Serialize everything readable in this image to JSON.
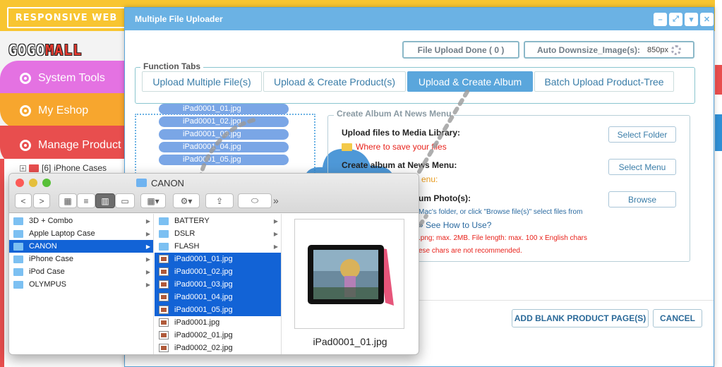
{
  "background": {
    "banner_text": "RESPONSIVE WEB",
    "brand_left": "GOGO",
    "brand_right": "MALL",
    "nav": [
      {
        "label": "System Tools"
      },
      {
        "label": "My Eshop"
      },
      {
        "label": "Manage Product"
      }
    ],
    "category": {
      "count": "[6]",
      "label": "iPhone Cases"
    }
  },
  "dialog": {
    "title": "Multiple File Uploader",
    "window_buttons": [
      "–",
      "⤢",
      "▾",
      "✕"
    ],
    "upload_done": "File Upload Done ( 0 )",
    "auto_downsize_label": "Auto Downsize_Image(s):",
    "auto_downsize_value": "850px",
    "function_tabs_legend": "Function Tabs",
    "tabs": [
      {
        "label": "Upload Multiple File(s)",
        "active": false
      },
      {
        "label": "Upload & Create Product(s)",
        "active": false
      },
      {
        "label": "Upload & Create Album",
        "active": true
      },
      {
        "label": "Batch Upload Product-Tree",
        "active": false
      }
    ],
    "dragged_files": [
      "iPad0001_01.jpg",
      "iPad0001_02.jpg",
      "iPad0001_03.jpg",
      "iPad0001_04.jpg",
      "iPad0001_05.jpg"
    ],
    "album": {
      "legend": "Create Album At News Menu",
      "upload_label": "Upload files to Media Library:",
      "where_save": "Where to save your files",
      "select_folder": "Select Folder",
      "create_label": "Create album at News Menu:",
      "create_note": "enu:",
      "select_menu": "Select Menu",
      "photo_label": "um Photo(s):",
      "browse": "Browse",
      "hint": "Mac's folder, or click \"Browse file(s)\" select files from",
      "howto": "» See How to Use?",
      "limits": ".png; max. 2MB. File length: max. 100 x English chars",
      "chars_note": "ese chars are not recommended."
    },
    "add_blank": "ADD BLANK PRODUCT PAGE(S)",
    "cancel": "CANCEL"
  },
  "finder": {
    "title": "CANON",
    "nav_back": "<",
    "nav_forward": ">",
    "more": "»",
    "col1": [
      {
        "label": "3D + Combo",
        "selected": false
      },
      {
        "label": "Apple Laptop Case",
        "selected": false
      },
      {
        "label": "CANON",
        "selected": true
      },
      {
        "label": "iPhone Case",
        "selected": false
      },
      {
        "label": "iPod Case",
        "selected": false
      },
      {
        "label": "OLYMPUS",
        "selected": false
      }
    ],
    "col2": [
      {
        "label": "BATTERY",
        "type": "folder",
        "selected": false
      },
      {
        "label": "DSLR",
        "type": "folder",
        "selected": false
      },
      {
        "label": "FLASH",
        "type": "folder",
        "selected": false
      },
      {
        "label": "iPad0001_01.jpg",
        "type": "image",
        "selected": true
      },
      {
        "label": "iPad0001_02.jpg",
        "type": "image",
        "selected": true
      },
      {
        "label": "iPad0001_03.jpg",
        "type": "image",
        "selected": true
      },
      {
        "label": "iPad0001_04.jpg",
        "type": "image",
        "selected": true
      },
      {
        "label": "iPad0001_05.jpg",
        "type": "image",
        "selected": true
      },
      {
        "label": "iPad0001.jpg",
        "type": "image",
        "selected": false
      },
      {
        "label": "iPad0002_01.jpg",
        "type": "image",
        "selected": false
      },
      {
        "label": "iPad0002_02.jpg",
        "type": "image",
        "selected": false
      }
    ],
    "preview_name": "iPad0001_01.jpg"
  },
  "colors": {
    "accent": "#5aa6dc",
    "selection": "#1263d6",
    "warning": "#e8221b"
  }
}
